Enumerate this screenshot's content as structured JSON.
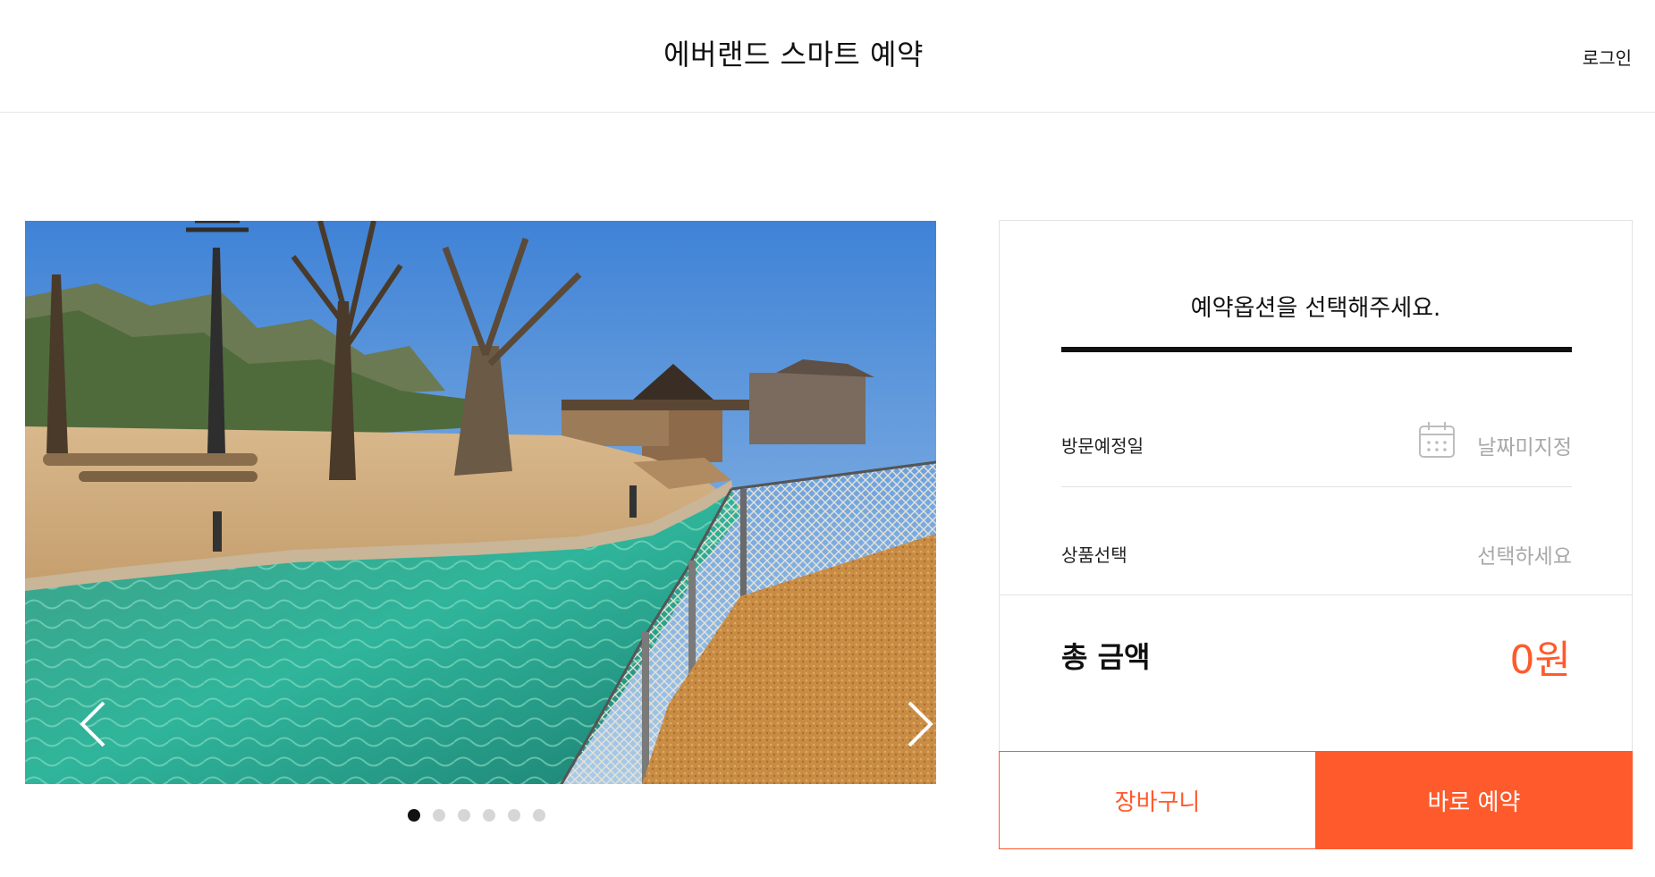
{
  "header": {
    "title": "에버랜드 스마트 예약",
    "login_label": "로그인"
  },
  "carousel": {
    "prev_icon": "chevron-left-icon",
    "next_icon": "chevron-right-icon",
    "slide_count": 6,
    "active_slide": 1
  },
  "booking": {
    "heading": "예약옵션을 선택해주세요.",
    "visit_date": {
      "label": "방문예정일",
      "value": "날짜미지정",
      "icon": "calendar-icon"
    },
    "product": {
      "label": "상품선택",
      "value": "선택하세요"
    },
    "total": {
      "label": "총 금액",
      "amount": "0원"
    },
    "cart_label": "장바구니",
    "book_now_label": "바로 예약"
  },
  "colors": {
    "accent": "#ff5a2c",
    "text": "#111111",
    "muted": "#a8a8a8",
    "border": "#e3e3e3"
  }
}
